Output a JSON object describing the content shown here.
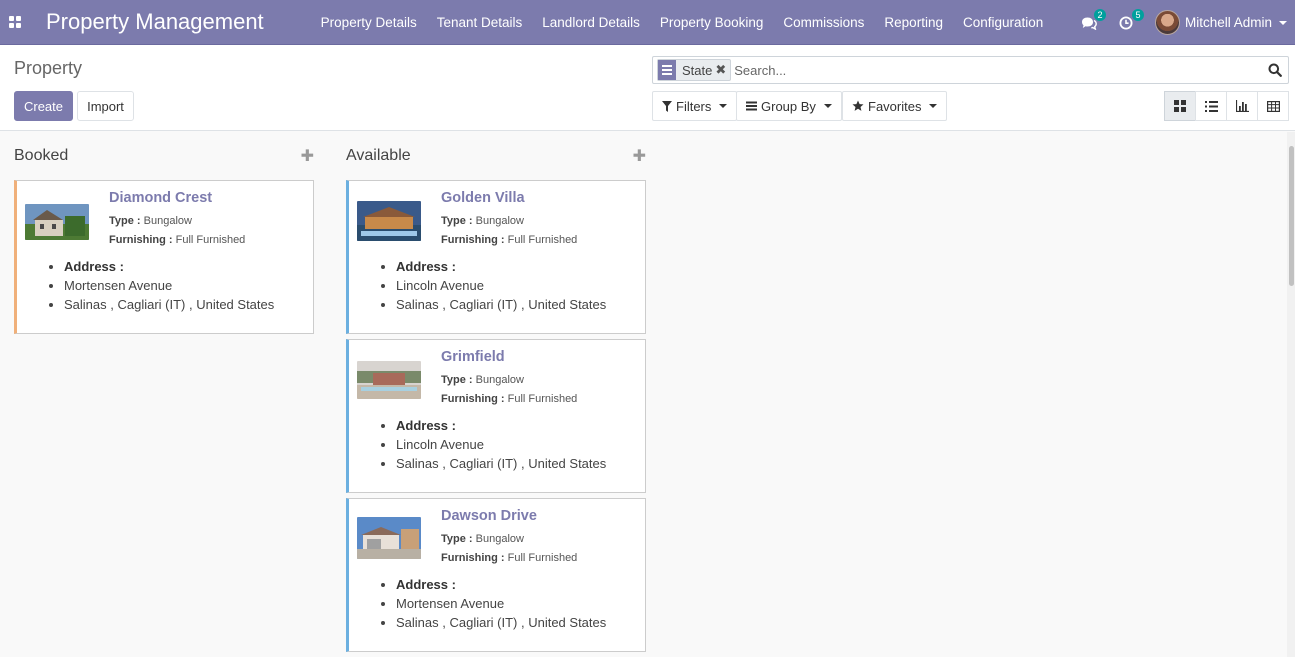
{
  "navbar": {
    "app_name": "Property Management",
    "menu": [
      "Property Details",
      "Tenant Details",
      "Landlord Details",
      "Property Booking",
      "Commissions",
      "Reporting",
      "Configuration"
    ],
    "messages_count": "2",
    "activities_count": "5",
    "user_name": "Mitchell Admin"
  },
  "control": {
    "breadcrumb": "Property",
    "create_label": "Create",
    "import_label": "Import",
    "search": {
      "facet_label": "State",
      "placeholder": "Search..."
    },
    "filters_label": "Filters",
    "groupby_label": "Group By",
    "favorites_label": "Favorites"
  },
  "kanban": {
    "columns": [
      {
        "title": "Booked",
        "cards": [
          {
            "name": "Diamond Crest",
            "type": "Bungalow",
            "furnishing": "Full Furnished",
            "street": "Mortensen Avenue",
            "city_line": "Salinas , Cagliari (IT) , United States"
          }
        ]
      },
      {
        "title": "Available",
        "cards": [
          {
            "name": "Golden Villa",
            "type": "Bungalow",
            "furnishing": "Full Furnished",
            "street": "Lincoln Avenue",
            "city_line": "Salinas , Cagliari (IT) , United States"
          },
          {
            "name": "Grimfield",
            "type": "Bungalow",
            "furnishing": "Full Furnished",
            "street": "Lincoln Avenue",
            "city_line": "Salinas , Cagliari (IT) , United States"
          },
          {
            "name": "Dawson Drive",
            "type": "Bungalow",
            "furnishing": "Full Furnished",
            "street": "Mortensen Avenue",
            "city_line": "Salinas , Cagliari (IT) , United States"
          }
        ]
      }
    ],
    "labels": {
      "type": "Type :",
      "furnishing": "Furnishing :",
      "address": "Address :"
    }
  },
  "colors": {
    "brand": "#7c7bad",
    "booked_stripe": "#f0b07a",
    "available_stripe": "#6cb0e0",
    "badge": "#00a09d"
  }
}
